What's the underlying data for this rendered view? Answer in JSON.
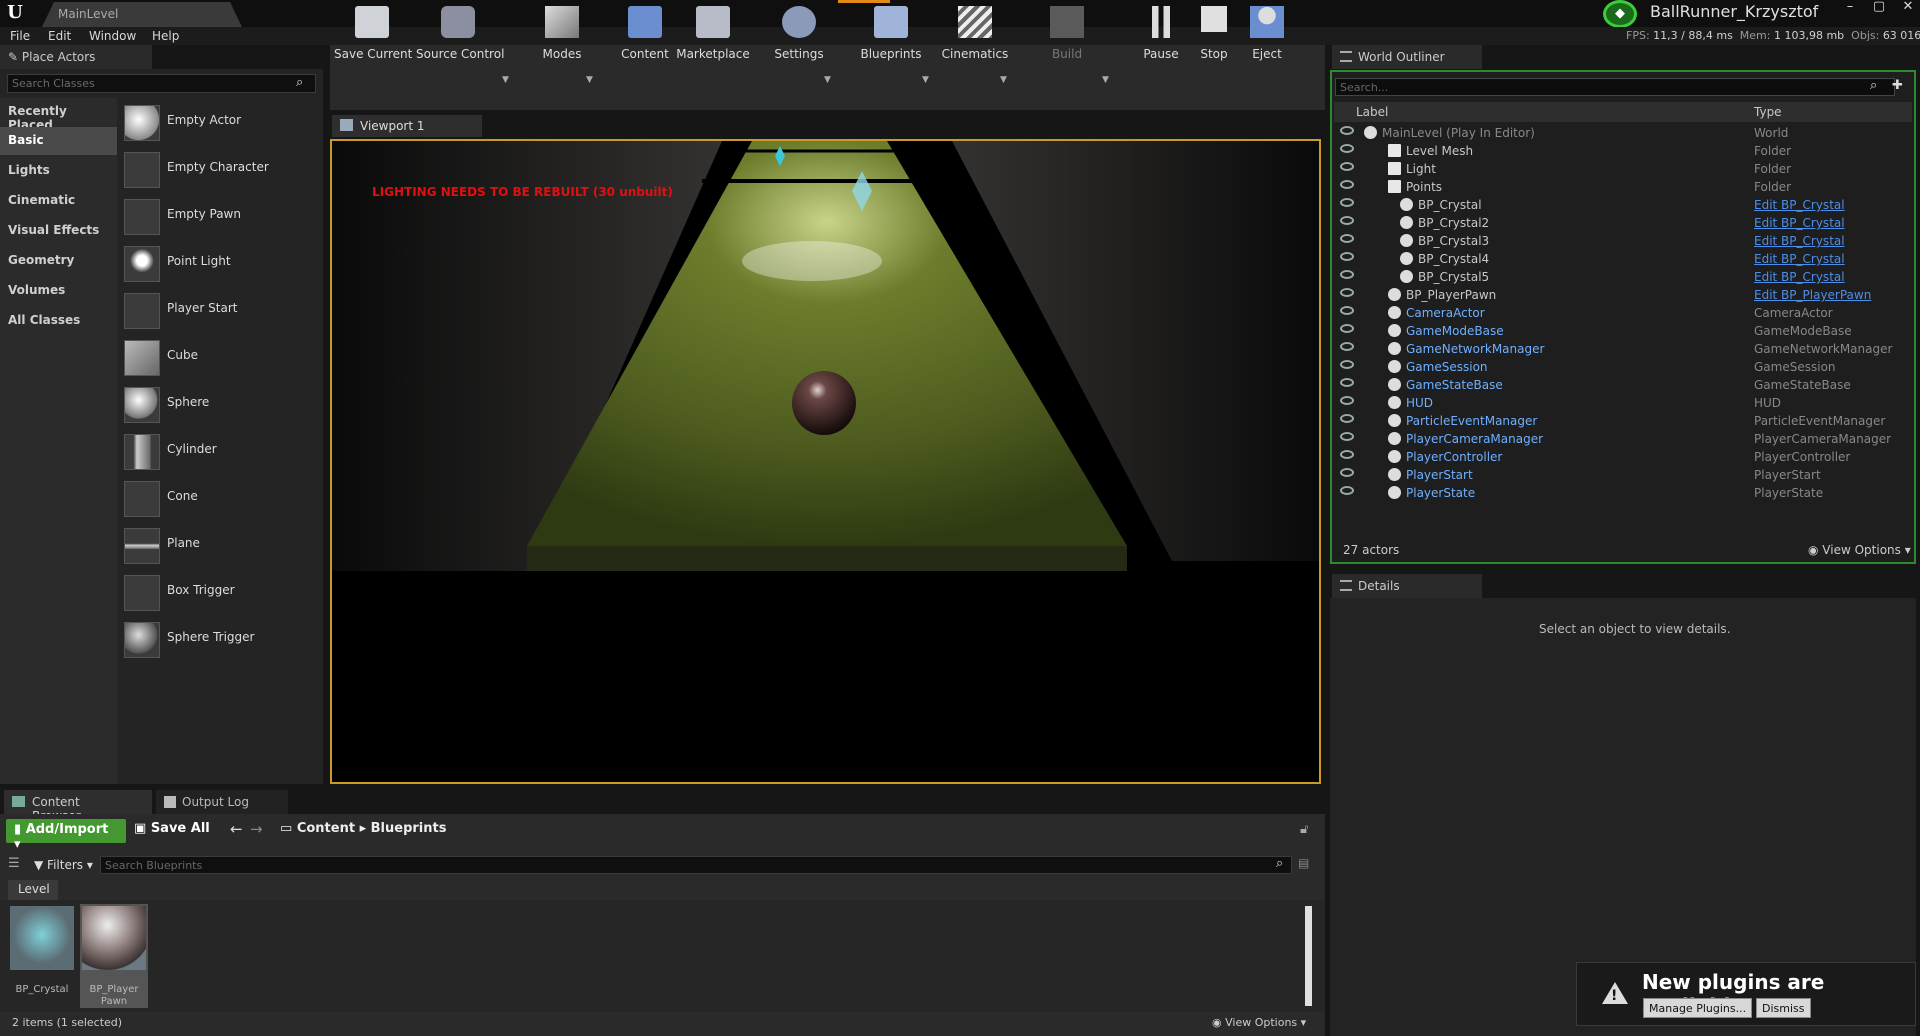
{
  "title_bar": {
    "logo": "U",
    "level_tab": "MainLevel",
    "project": "BallRunner_Krzysztof",
    "min": "–",
    "max": "▢",
    "close": "✕"
  },
  "menu": [
    "File",
    "Edit",
    "Window",
    "Help"
  ],
  "stats": {
    "fps_label": "FPS:",
    "fps": "11,3",
    "ms": "/ 88,4 ms",
    "mem_label": "Mem:",
    "mem": "1 103,98 mb",
    "objs_label": "Objs:",
    "objs": "63 016"
  },
  "place_actors": {
    "tab": "Place Actors",
    "search_placeholder": "Search Classes",
    "categories": [
      "Recently Placed",
      "Basic",
      "Lights",
      "Cinematic",
      "Visual Effects",
      "Geometry",
      "Volumes",
      "All Classes"
    ],
    "selected_category": "Basic",
    "actors": [
      "Empty Actor",
      "Empty Character",
      "Empty Pawn",
      "Point Light",
      "Player Start",
      "Cube",
      "Sphere",
      "Cylinder",
      "Cone",
      "Plane",
      "Box Trigger",
      "Sphere Trigger"
    ]
  },
  "toolbar": [
    "Save Current",
    "Source Control",
    "Modes",
    "Content",
    "Marketplace",
    "Settings",
    "Blueprints",
    "Cinematics",
    "Build",
    "Pause",
    "Stop",
    "Eject"
  ],
  "viewport": {
    "tab": "Viewport 1",
    "warning": "LIGHTING NEEDS TO BE REBUILT (30 unbuilt)"
  },
  "outliner": {
    "tab": "World Outliner",
    "search_placeholder": "Search...",
    "col_label": "Label",
    "col_type": "Type",
    "rows": [
      {
        "label": "MainLevel (Play In Editor)",
        "type": "World",
        "link": false
      },
      {
        "label": "Level Mesh",
        "type": "Folder",
        "link": false
      },
      {
        "label": "Light",
        "type": "Folder",
        "link": false
      },
      {
        "label": "Points",
        "type": "Folder",
        "link": false
      },
      {
        "label": "BP_Crystal",
        "type": "Edit BP_Crystal",
        "link": true
      },
      {
        "label": "BP_Crystal2",
        "type": "Edit BP_Crystal",
        "link": true
      },
      {
        "label": "BP_Crystal3",
        "type": "Edit BP_Crystal",
        "link": true
      },
      {
        "label": "BP_Crystal4",
        "type": "Edit BP_Crystal",
        "link": true
      },
      {
        "label": "BP_Crystal5",
        "type": "Edit BP_Crystal",
        "link": true
      },
      {
        "label": "BP_PlayerPawn",
        "type": "Edit BP_PlayerPawn",
        "link": true
      },
      {
        "label": "CameraActor",
        "type": "CameraActor",
        "link": false
      },
      {
        "label": "GameModeBase",
        "type": "GameModeBase",
        "link": false
      },
      {
        "label": "GameNetworkManager",
        "type": "GameNetworkManager",
        "link": false
      },
      {
        "label": "GameSession",
        "type": "GameSession",
        "link": false
      },
      {
        "label": "GameStateBase",
        "type": "GameStateBase",
        "link": false
      },
      {
        "label": "HUD",
        "type": "HUD",
        "link": false
      },
      {
        "label": "ParticleEventManager",
        "type": "ParticleEventManager",
        "link": false
      },
      {
        "label": "PlayerCameraManager",
        "type": "PlayerCameraManager",
        "link": false
      },
      {
        "label": "PlayerController",
        "type": "PlayerController",
        "link": false
      },
      {
        "label": "PlayerStart",
        "type": "PlayerStart",
        "link": false
      },
      {
        "label": "PlayerState",
        "type": "PlayerState",
        "link": false
      }
    ],
    "count": "27 actors",
    "view_options": "View Options"
  },
  "details": {
    "tab": "Details",
    "message": "Select an object to view details."
  },
  "content_browser": {
    "tab": "Content Browser",
    "output_tab": "Output Log",
    "add_import": "Add/Import",
    "save_all": "Save All",
    "crumbs": [
      "Content",
      "Blueprints"
    ],
    "filters": "Filters",
    "search_placeholder": "Search Blueprints",
    "level_chip": "Level",
    "assets": [
      "BP_Crystal",
      "BP_Player Pawn"
    ],
    "items": "2 items (1 selected)",
    "view_options": "View Options"
  },
  "toast": {
    "title": "New plugins are available",
    "manage": "Manage Plugins...",
    "dismiss": "Dismiss"
  }
}
